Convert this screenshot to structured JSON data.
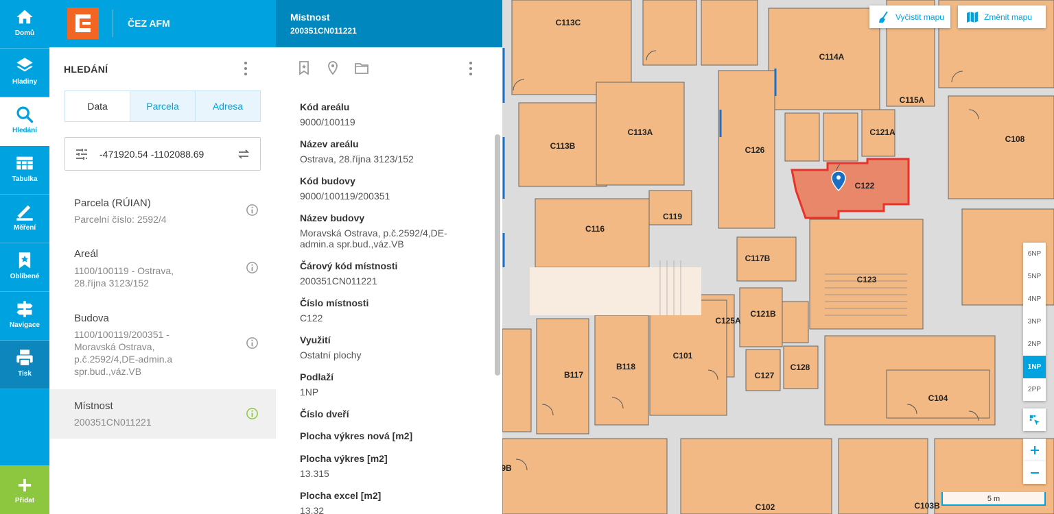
{
  "app": {
    "title": "ČEZ AFM"
  },
  "rail": {
    "items": [
      {
        "label": "Domů",
        "icon": "home-icon"
      },
      {
        "label": "Hladiny",
        "icon": "layers-icon"
      },
      {
        "label": "Hledání",
        "icon": "search-icon"
      },
      {
        "label": "Tabulka",
        "icon": "table-icon"
      },
      {
        "label": "Měření",
        "icon": "ruler-icon"
      },
      {
        "label": "Oblíbené",
        "icon": "bookmark-star-icon"
      },
      {
        "label": "Navigace",
        "icon": "signpost-icon"
      },
      {
        "label": "Tisk",
        "icon": "printer-icon"
      }
    ],
    "add_label": "Přidat",
    "active_item": "Hledání"
  },
  "search": {
    "title": "HLEDÁNÍ",
    "tabs": [
      {
        "label": "Data",
        "active": true
      },
      {
        "label": "Parcela",
        "active": false
      },
      {
        "label": "Adresa",
        "active": false
      }
    ],
    "coordinates": "-471920.54 -1102088.69",
    "results": [
      {
        "title": "Parcela (RÚIAN)",
        "subtitle": "Parcelní číslo: 2592/4"
      },
      {
        "title": "Areál",
        "subtitle": "1100/100119 - Ostrava, 28.října 3123/152"
      },
      {
        "title": "Budova",
        "subtitle": "1100/100119/200351 - Moravská Ostrava, p.č.2592/4,DE-admin.a spr.bud.,váz.VB"
      },
      {
        "title": "Místnost",
        "subtitle": "200351CN011221",
        "selected": true
      }
    ]
  },
  "detail": {
    "title": "Místnost",
    "subtitle": "200351CN011221",
    "tools": [
      "bookmark-icon",
      "location-pin-icon",
      "folder-icon"
    ],
    "fields": [
      {
        "label": "Kód areálu",
        "value": "9000/100119"
      },
      {
        "label": "Název areálu",
        "value": "Ostrava, 28.října 3123/152"
      },
      {
        "label": "Kód budovy",
        "value": "9000/100119/200351"
      },
      {
        "label": "Název budovy",
        "value": "Moravská Ostrava, p.č.2592/4,DE-admin.a spr.bud.,váz.VB"
      },
      {
        "label": "Čárový kód místnosti",
        "value": "200351CN011221"
      },
      {
        "label": "Číslo místnosti",
        "value": "C122"
      },
      {
        "label": "Využití",
        "value": "Ostatní plochy"
      },
      {
        "label": "Podlaží",
        "value": "1NP"
      },
      {
        "label": "Číslo dveří",
        "value": ""
      },
      {
        "label": "Plocha výkres nová [m2]",
        "value": ""
      },
      {
        "label": "Plocha výkres [m2]",
        "value": "13.315"
      },
      {
        "label": "Plocha excel [m2]",
        "value": "13.32"
      }
    ]
  },
  "map": {
    "buttons": {
      "clear": "Vyčistit mapu",
      "change": "Změnit mapu"
    },
    "floors": [
      "6NP",
      "5NP",
      "4NP",
      "3NP",
      "2NP",
      "1NP",
      "2PP"
    ],
    "active_floor": "1NP",
    "scale_label": "5 m",
    "rooms": [
      "C113C",
      "C114A",
      "C115A",
      "C113A",
      "C113B",
      "C121A",
      "C108",
      "C126",
      "C122",
      "C116",
      "C119",
      "C117B",
      "C123",
      "C125A",
      "C121B",
      "C101",
      "B117",
      "B118",
      "C127",
      "C128",
      "C104",
      "C102",
      "C103B",
      "9B"
    ],
    "selected_room": "C122",
    "colors": {
      "room": "#f2b984",
      "wall": "#d8d8d8",
      "selected": "#e8332a",
      "accent": "#00a3e0",
      "logo": "#f26522",
      "add": "#8dc63f"
    }
  }
}
